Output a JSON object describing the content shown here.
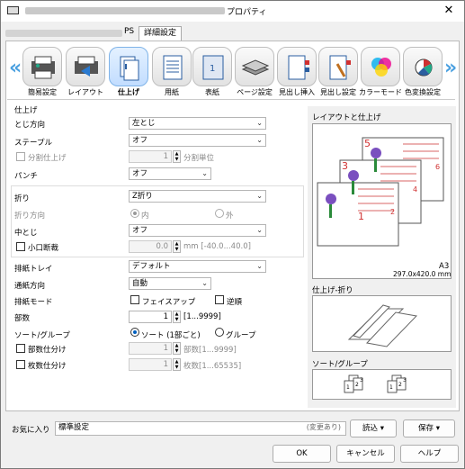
{
  "window": {
    "title": "プロパティ",
    "close_glyph": "✕"
  },
  "tabs": {
    "main_suffix": "PS",
    "detail": "詳細設定"
  },
  "toolbar": {
    "items": [
      {
        "label": "簡易設定",
        "icon": "easy-settings-icon"
      },
      {
        "label": "レイアウト",
        "icon": "layout-icon"
      },
      {
        "label": "仕上げ",
        "icon": "finishing-icon",
        "selected": true
      },
      {
        "label": "用紙",
        "icon": "paper-icon"
      },
      {
        "label": "表紙",
        "icon": "cover-icon"
      },
      {
        "label": "ページ設定",
        "icon": "page-setup-icon"
      },
      {
        "label": "見出し挿入",
        "icon": "tab-insert-icon"
      },
      {
        "label": "見出し設定",
        "icon": "tab-settings-icon"
      },
      {
        "label": "カラーモード",
        "icon": "color-mode-icon"
      },
      {
        "label": "色変換設定",
        "icon": "color-conversion-icon"
      }
    ],
    "left_arrow": "«",
    "right_arrow": "»"
  },
  "finish": {
    "section_title": "仕上げ",
    "binding": {
      "label": "とじ方向",
      "value": "左とじ"
    },
    "staple": {
      "label": "ステープル",
      "value": "オフ"
    },
    "split": {
      "label": "分割仕上げ",
      "value": "1",
      "unit": "分割単位"
    },
    "punch": {
      "label": "パンチ",
      "value": "オフ"
    },
    "fold": {
      "label": "折り",
      "value": "Z折り"
    },
    "fold_dir": {
      "label": "折り方向",
      "opt1": "内",
      "opt2": "外"
    },
    "saddle": {
      "label": "中とじ",
      "value": "オフ"
    },
    "trim": {
      "label": "小口断裁",
      "value": "0.0",
      "unit": "mm [-40.0...40.0]"
    },
    "tray": {
      "label": "排紙トレイ",
      "value": "デフォルト"
    },
    "feed": {
      "label": "通紙方向",
      "value": "自動"
    },
    "output": {
      "label": "排紙モード",
      "opt1": "フェイスアップ",
      "opt2": "逆順"
    },
    "copies": {
      "label": "部数",
      "value": "1",
      "range": "[1...9999]"
    },
    "sort": {
      "label": "ソート/グループ",
      "opt1": "ソート (1部ごと)",
      "opt2": "グループ"
    },
    "copy_sep": {
      "label": "部数仕分け",
      "value": "1",
      "unit": "部数[1...9999]"
    },
    "sheet_sep": {
      "label": "枚数仕分け",
      "value": "1",
      "unit": "枚数[1...65535]"
    }
  },
  "preview": {
    "layout_title": "レイアウトと仕上げ",
    "paper": "A3",
    "dims": "297.0x420.0 mm",
    "page_nums": [
      "5",
      "6",
      "3",
      "4",
      "1",
      "2"
    ],
    "fold_title": "仕上げ-折り",
    "sort_title": "ソート/グループ",
    "sort_nums": [
      "1",
      "2",
      "3",
      "1",
      "2",
      "3"
    ]
  },
  "favorites": {
    "label": "お気に入り",
    "value": "標準設定",
    "changed": "(変更あり)",
    "read": "読込",
    "save": "保存"
  },
  "buttons": {
    "ok": "OK",
    "cancel": "キャンセル",
    "help": "ヘルプ"
  },
  "colors": {
    "accent": "#4aa0e0",
    "selected_bg": "#c2ddff",
    "page_red": "#d03030"
  }
}
